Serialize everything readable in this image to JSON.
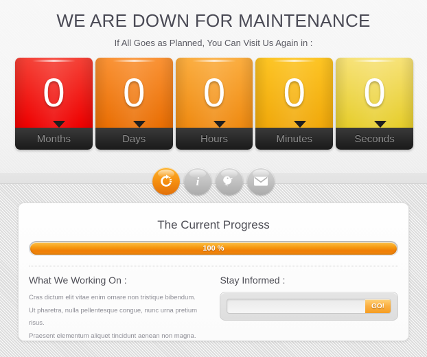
{
  "header": {
    "headline": "WE ARE DOWN FOR MAINTENANCE",
    "subline": "If All Goes as Planned, You Can Visit Us Again in :"
  },
  "countdown": {
    "units": [
      {
        "value": "0",
        "label": "Months",
        "color_top": "#f54136",
        "color_bottom": "#ee0000"
      },
      {
        "value": "0",
        "label": "Days",
        "color_top": "#fa9234",
        "color_bottom": "#e96e03"
      },
      {
        "value": "0",
        "label": "Hours",
        "color_top": "#fbb košer",
        "color_bottom": "#ef8c12"
      },
      {
        "value": "0",
        "label": "Minutes",
        "color_top": "#fdc githu",
        "color_bottom": "#f0a80a"
      },
      {
        "value": "0",
        "label": "Seconds",
        "color_top": "#f6e06a",
        "color_bottom": "#e8cf2a"
      }
    ]
  },
  "social": {
    "items": [
      {
        "icon": "refresh-icon",
        "accent": true
      },
      {
        "icon": "info-icon",
        "accent": false
      },
      {
        "icon": "bird-icon",
        "accent": false
      },
      {
        "icon": "envelope-icon",
        "accent": false
      }
    ]
  },
  "panel": {
    "title": "The Current Progress",
    "progress": {
      "percent": 100,
      "label": "100 %"
    },
    "working_on": {
      "heading": "What We Working On :",
      "lines": [
        "Cras dictum elit vitae enim ornare non tristique bibendum.",
        "Ut pharetra, nulla pellentesque congue, nunc urna pretium risus.",
        "Praesent elementum aliquet tincidunt aenean non magna."
      ]
    },
    "subscribe": {
      "heading": "Stay Informed :",
      "value": "",
      "placeholder": "",
      "button_label": "GO!"
    }
  },
  "colors": {
    "accent": "#f58f10",
    "headline": "#4a4a55",
    "body_text": "#8e8e96"
  }
}
